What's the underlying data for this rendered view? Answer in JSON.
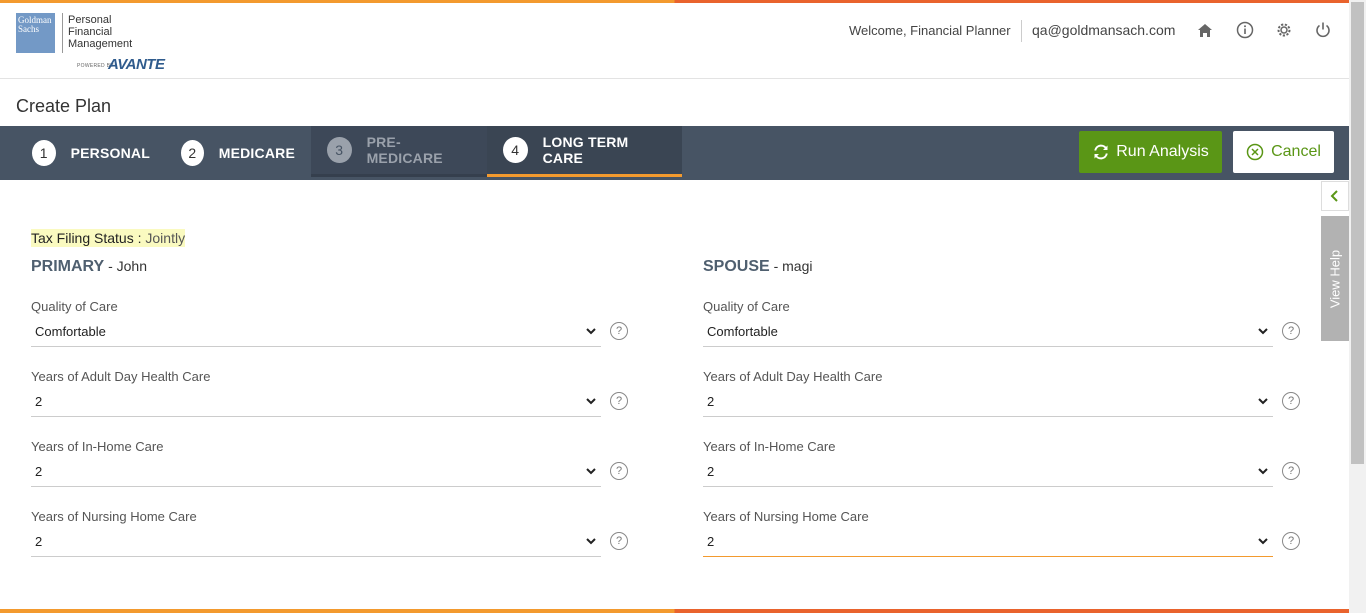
{
  "header": {
    "logo_brand": "Goldman Sachs",
    "logo_product": [
      "Personal",
      "Financial",
      "Management"
    ],
    "powered_by": "POWERED BY",
    "powered_brand": "AVANTE",
    "welcome": "Welcome, Financial Planner",
    "email": "qa@goldmansach.com",
    "icons": [
      "home-icon",
      "info-icon",
      "gear-icon",
      "power-icon"
    ]
  },
  "page": {
    "title": "Create Plan"
  },
  "steps": [
    {
      "num": "1",
      "label": "PERSONAL"
    },
    {
      "num": "2",
      "label": "MEDICARE"
    },
    {
      "num": "3",
      "label": "PRE-MEDICARE"
    },
    {
      "num": "4",
      "label": "LONG TERM CARE"
    }
  ],
  "actions": {
    "run": "Run Analysis",
    "cancel": "Cancel"
  },
  "tax": {
    "label": "Tax Filing Status : ",
    "value": "Jointly"
  },
  "primary": {
    "heading": "PRIMARY",
    "name": " - John",
    "fields": [
      {
        "label": "Quality of Care",
        "value": "Comfortable"
      },
      {
        "label": "Years of Adult Day Health Care",
        "value": "2"
      },
      {
        "label": "Years of In-Home Care",
        "value": "2"
      },
      {
        "label": "Years of Nursing Home Care",
        "value": "2"
      }
    ]
  },
  "spouse": {
    "heading": "SPOUSE",
    "name": " - magi",
    "fields": [
      {
        "label": "Quality of Care",
        "value": "Comfortable"
      },
      {
        "label": "Years of Adult Day Health Care",
        "value": "2"
      },
      {
        "label": "Years of In-Home Care",
        "value": "2"
      },
      {
        "label": "Years of Nursing Home Care",
        "value": "2"
      }
    ]
  },
  "help_panel": {
    "label": "View Help"
  },
  "colors": {
    "accent": "#f39a2e",
    "stepbar": "#475464",
    "run": "#5a9616"
  }
}
